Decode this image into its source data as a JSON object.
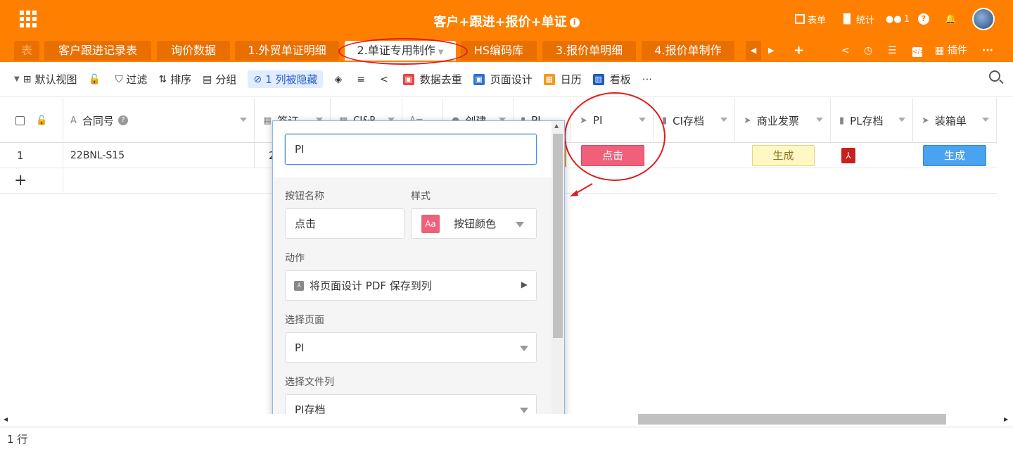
{
  "app": {
    "title": "客户+跟进+报价+单证",
    "title_info": "i",
    "tools": {
      "form": "表单",
      "stats": "统计",
      "member_count": "1",
      "help": "?",
      "bell": "🔔"
    }
  },
  "tabs": [
    {
      "label": "表"
    },
    {
      "label": "客户跟进记录表"
    },
    {
      "label": "询价数据"
    },
    {
      "label": "1.外贸单证明细"
    },
    {
      "label": "2.单证专用制作",
      "active": true
    },
    {
      "label": "HS编码库"
    },
    {
      "label": "3.报价单明细"
    },
    {
      "label": "4.报价单制作"
    }
  ],
  "tab_controls": {
    "prev": "◀",
    "next": "▶",
    "add": "+",
    "plugins": "插件",
    "more": "···"
  },
  "toolbar": {
    "view": "默认视图",
    "filter": "过滤",
    "sort": "排序",
    "group": "分组",
    "hidden": "1 列被隐藏",
    "dedupe": "数据去重",
    "page_design": "页面设计",
    "calendar": "日历",
    "kanban": "看板",
    "more": "···"
  },
  "columns": [
    {
      "label": "合同号"
    },
    {
      "label": "签订"
    },
    {
      "label": "CI&P"
    },
    {
      "label": "创建"
    },
    {
      "label": "PI"
    },
    {
      "label": "PI"
    },
    {
      "label": "CI存档"
    },
    {
      "label": "商业发票"
    },
    {
      "label": "PL存档"
    },
    {
      "label": "装箱单"
    }
  ],
  "rows": [
    {
      "index": "1",
      "contract": "22BNL-S15",
      "signed": "2",
      "pi_button": "点击",
      "invoice_button": "生成",
      "packing_button": "生成"
    }
  ],
  "add_row": "+",
  "popup": {
    "name_value": "PI",
    "button_name_label": "按钮名称",
    "button_name_value": "点击",
    "style_label": "样式",
    "style_swatch": "Aa",
    "style_value": "按钮颜色",
    "action_label": "动作",
    "action_value": "将页面设计 PDF 保存到列",
    "page_label": "选择页面",
    "page_value": "PI",
    "file_col_label": "选择文件列",
    "file_col_value": "PI存档"
  },
  "footer": {
    "row_count": "1 行"
  },
  "colors": {
    "brand": "#ff8000",
    "pi_button": "#f0607a",
    "invoice_button": "#fff8c4",
    "packing_button": "#4aa3f0",
    "annotation": "#e31b1b"
  }
}
